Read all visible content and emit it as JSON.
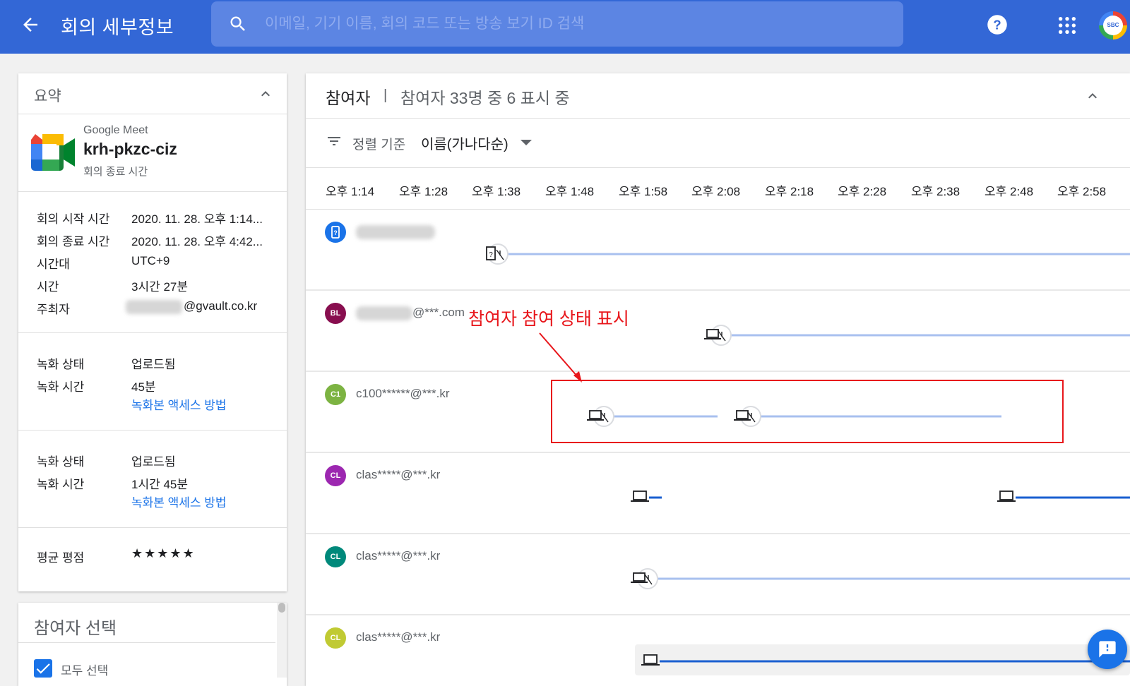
{
  "header": {
    "title": "회의 세부정보",
    "search_placeholder": "이메일, 기기 이름, 회의 코드 또는 방송 보기 ID 검색",
    "account_label": "SBC"
  },
  "summary": {
    "section_title": "요약",
    "meeting": {
      "app_name": "Google Meet",
      "code": "krh-pkzc-ciz",
      "status": "회의 종료 시간"
    },
    "details": [
      {
        "label": "회의 시작 시간",
        "value": "2020. 11. 28. 오후 1:14..."
      },
      {
        "label": "회의 종료 시간",
        "value": "2020. 11. 28. 오후 4:42..."
      },
      {
        "label": "시간대",
        "value": "UTC+9"
      },
      {
        "label": "시간",
        "value": "3시간 27분"
      },
      {
        "label": "주최자",
        "value": "@gvault.co.kr"
      }
    ],
    "recordings": [
      {
        "status_label": "녹화 상태",
        "status_value": "업로드됨",
        "time_label": "녹화 시간",
        "time_value": "45분",
        "link": "녹화본 액세스 방법"
      },
      {
        "status_label": "녹화 상태",
        "status_value": "업로드됨",
        "time_label": "녹화 시간",
        "time_value": "1시간 45분",
        "link": "녹화본 액세스 방법"
      }
    ],
    "rating_label": "평균 평점",
    "rating_stars": "★★★★★"
  },
  "participant_select": {
    "title": "참여자 선택",
    "select_all_label": "모두 선택"
  },
  "participants_panel": {
    "title": "참여자",
    "separator": "|",
    "count_text": "참여자 33명 중 6 표시 중",
    "sort_label": "정렬 기준",
    "sort_value": "이름(가나다순)",
    "time_ticks": [
      "오후 1:14",
      "오후 1:28",
      "오후 1:38",
      "오후 1:48",
      "오후 1:58",
      "오후 2:08",
      "오후 2:18",
      "오후 2:28",
      "오후 2:38",
      "오후 2:48",
      "오후 2:58"
    ],
    "rows": [
      {
        "initials": "",
        "name": "",
        "avatar_color": "#1a73e8",
        "avatar_icon": "phone-icon",
        "device": "phone",
        "muted": true
      },
      {
        "initials": "BL",
        "name": "@***.com",
        "avatar_color": "#880e4f",
        "device": "laptop",
        "muted": true
      },
      {
        "initials": "C1",
        "name": "c100******@***.kr",
        "avatar_color": "#7cb342",
        "device": "laptop",
        "muted": true
      },
      {
        "initials": "CL",
        "name": "clas*****@***.kr",
        "avatar_color": "#9c27b0",
        "device": "laptop",
        "muted": false
      },
      {
        "initials": "CL",
        "name": "clas*****@***.kr",
        "avatar_color": "#00897b",
        "device": "laptop",
        "muted": true
      },
      {
        "initials": "CL",
        "name": "clas*****@***.kr",
        "avatar_color": "#c0ca33",
        "device": "laptop",
        "muted": false
      }
    ]
  },
  "annotation": {
    "text": "참여자 참여 상태 표시",
    "color": "#e8161b"
  },
  "colors": {
    "header_bg": "#3367d6",
    "accent": "#1a73e8",
    "timeline_muted": "#a8c0ef",
    "timeline_active": "#1a5fd0"
  }
}
